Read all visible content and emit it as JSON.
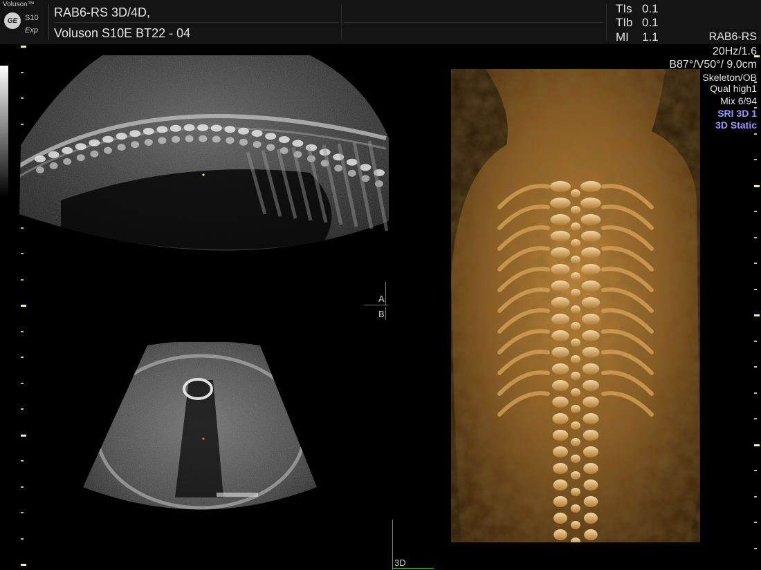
{
  "header": {
    "brand_name": "Voluson™",
    "brand_logo": "GE",
    "brand_model": "S10",
    "brand_exp": "Exp",
    "patient_line1": "RAB6-RS 3D/4D,",
    "patient_line2": "Voluson S10E BT22 - 04",
    "indices": [
      {
        "label": "TIs",
        "value": "0.1"
      },
      {
        "label": "TIb",
        "value": "0.1"
      },
      {
        "label": "MI",
        "value": "1.1"
      }
    ]
  },
  "info_panel": {
    "probe": "RAB6-RS",
    "frame": "20Hz/1.6",
    "angles": "B87°/V50°/ 9.0cm",
    "preset": "Skeleton/OB",
    "quality": "Qual high1",
    "mix": "Mix 6/94",
    "sri": "SRI 3D 1",
    "mode": "3D Static"
  },
  "planes": {
    "a_label": "A",
    "b_label": "B",
    "render_label": "3D"
  },
  "colors": {
    "background": "#000000",
    "header": "#141414",
    "mode_text": "#9a9cff",
    "scale_major": "#f2ef9e",
    "render_tone": "#c58a3a",
    "marker_green": "#2fbf3a"
  }
}
